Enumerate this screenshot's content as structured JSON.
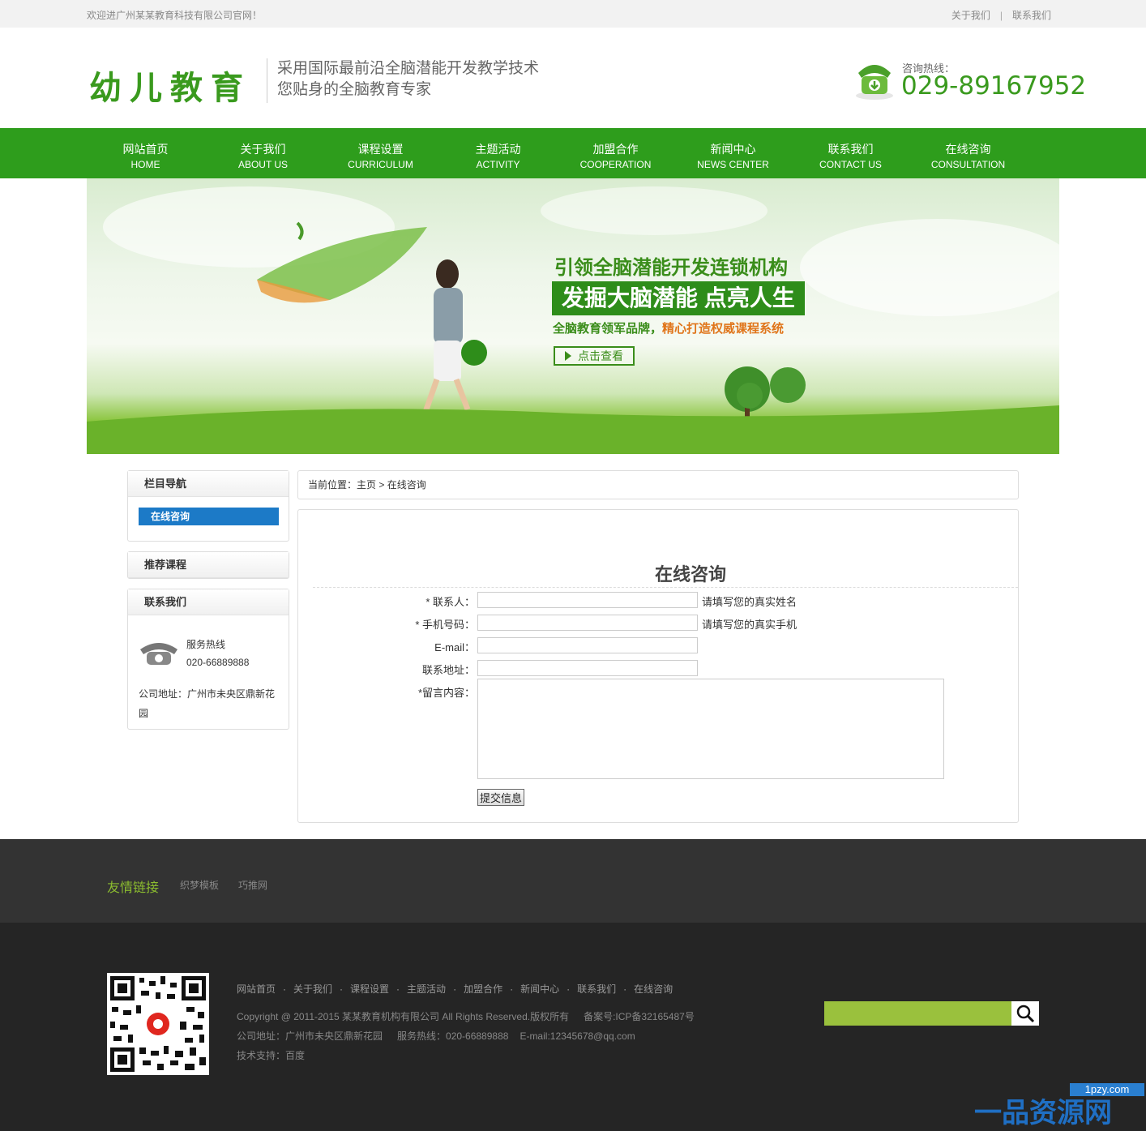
{
  "topbar": {
    "welcome": "欢迎进广州某某教育科技有限公司官网！",
    "about": "关于我们",
    "sep": "|",
    "contact": "联系我们"
  },
  "header": {
    "logo": "幼儿教育",
    "slogan1": "采用国际最前沿全脑潜能开发教学技术",
    "slogan2": "您贴身的全脑教育专家",
    "hotline_label": "咨询热线：",
    "hotline": "029-89167952"
  },
  "nav": [
    {
      "cn": "网站首页",
      "en": "HOME"
    },
    {
      "cn": "关于我们",
      "en": "ABOUT US"
    },
    {
      "cn": "课程设置",
      "en": "CURRICULUM"
    },
    {
      "cn": "主题活动",
      "en": "ACTIVITY"
    },
    {
      "cn": "加盟合作",
      "en": "COOPERATION"
    },
    {
      "cn": "新闻中心",
      "en": "NEWS CENTER"
    },
    {
      "cn": "联系我们",
      "en": "CONTACT US"
    },
    {
      "cn": "在线咨询",
      "en": "CONSULTATION"
    }
  ],
  "banner": {
    "line1": "引领全脑潜能开发连锁机构",
    "line2": "发掘大脑潜能 点亮人生",
    "line3a": "全脑教育领军品牌，",
    "line3b": "精心打造权威课程系统",
    "button": "点击查看"
  },
  "sidebar": {
    "nav_title": "栏目导航",
    "nav_item": "在线咨询",
    "courses_title": "推荐课程",
    "contact_title": "联系我们",
    "hotline_label": "服务热线",
    "hotline": "020-66889888",
    "address": "公司地址：广州市未央区鼎新花园"
  },
  "breadcrumb": {
    "prefix": "当前位置：",
    "home": "主页",
    "sep": ">",
    "current": "在线咨询"
  },
  "form": {
    "title": "在线咨询",
    "name_label": "* 联系人：",
    "name_value": "",
    "name_hint": "请填写您的真实姓名",
    "phone_label": "* 手机号码：",
    "phone_value": "",
    "phone_hint": "请填写您的真实手机",
    "email_label": "E-mail：",
    "email_value": "",
    "address_label": "联系地址：",
    "address_value": "",
    "message_label": "*留言内容：",
    "submit": "提交信息"
  },
  "friend_links": {
    "title": "友情链接",
    "links": [
      "织梦模板",
      "巧推网"
    ]
  },
  "footer": {
    "nav": [
      "网站首页",
      "关于我们",
      "课程设置",
      "主题活动",
      "加盟合作",
      "新闻中心",
      "联系我们",
      "在线咨询"
    ],
    "dot": "·",
    "copyright": "Copyright @ 2011-2015 某某教育机构有限公司 All Rights Reserved.版权所有",
    "icp": "备案号:ICP备32165487号",
    "address": "公司地址：广州市未央区鼎新花园",
    "hotline": "服务热线：020-66889888",
    "email": "E-mail:12345678@qq.com",
    "support": "技术支持：百度",
    "search_placeholder": ""
  },
  "watermark": {
    "domain": "1pzy.com",
    "name": "一品资源网"
  },
  "colors": {
    "brand_green": "#2e9d1c",
    "accent_blue": "#1c7ac7",
    "footer_green": "#9ac13d"
  }
}
